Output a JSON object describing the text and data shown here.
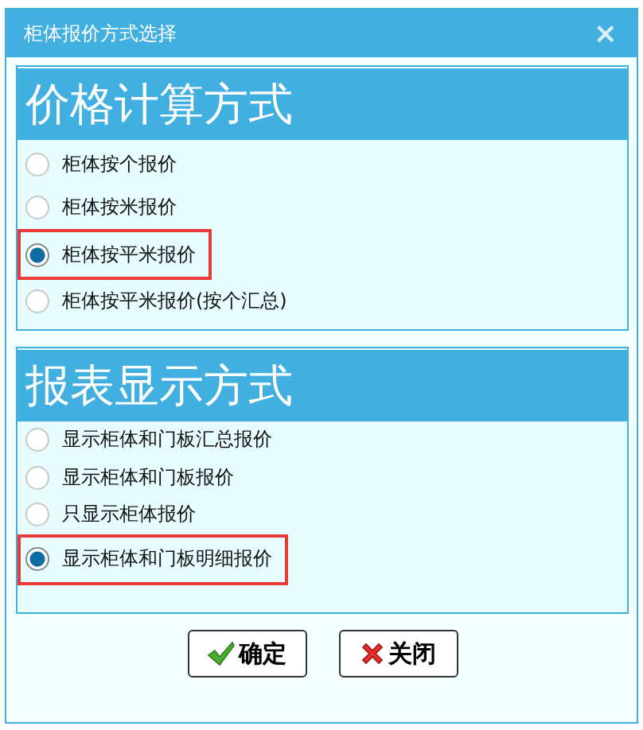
{
  "window": {
    "title": "柜体报价方式选择",
    "close": "×"
  },
  "groups": [
    {
      "title": "价格计算方式",
      "options": [
        {
          "label": "柜体按个报价",
          "selected": false
        },
        {
          "label": "柜体按米报价",
          "selected": false
        },
        {
          "label": "柜体按平米报价",
          "selected": true
        },
        {
          "label": "柜体按平米报价(按个汇总)",
          "selected": false
        }
      ]
    },
    {
      "title": "报表显示方式",
      "options": [
        {
          "label": "显示柜体和门板汇总报价",
          "selected": false
        },
        {
          "label": "显示柜体和门板报价",
          "selected": false
        },
        {
          "label": "只显示柜体报价",
          "selected": false
        },
        {
          "label": "显示柜体和门板明细报价",
          "selected": true
        }
      ]
    }
  ],
  "buttons": [
    {
      "kind": "ok",
      "label": "确定"
    },
    {
      "kind": "close",
      "label": "关闭"
    }
  ]
}
